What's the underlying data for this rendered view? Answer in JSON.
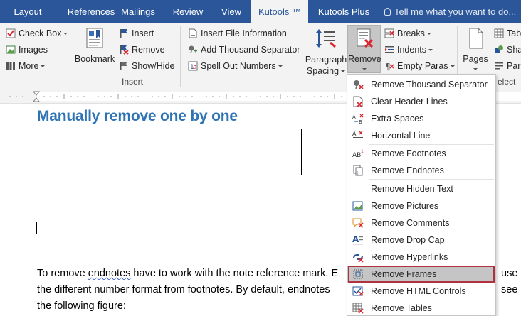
{
  "tabs": [
    "Layout",
    "References",
    "Mailings",
    "Review",
    "View",
    "Kutools ™",
    "Kutools Plus"
  ],
  "tell_me": "Tell me what you want to do...",
  "ribbon": {
    "checkbox": "Check Box",
    "images": "Images",
    "more": "More",
    "bookmark": "Bookmark",
    "insert": "Insert",
    "remove": "Remove",
    "show_hide": "Show/Hide",
    "group_insert": "Insert",
    "insert_file_info": "Insert File Information",
    "add_thousand_sep": "Add Thousand Separator",
    "spell_out_numbers": "Spell Out Numbers",
    "paragraph": "Paragraph",
    "spacing": "Spacing",
    "remove_big": "Remove",
    "breaks": "Breaks",
    "indents": "Indents",
    "empty_paras": "Empty Paras",
    "pages": "Pages",
    "table_short": "Tabl",
    "shape_short": "Shap",
    "para_short": "Para",
    "group_select": "elect"
  },
  "document": {
    "heading": "Manually remove one by one",
    "para_line1_a": "To remove ",
    "para_line1_b": "endnotes",
    "para_line1_c": " have to work with the note reference mark. E",
    "para_line1_end": "use",
    "para_line2": "the different number format from footnotes. By default, endnotes",
    "para_line2_end": "see",
    "para_line3": "the following figure:"
  },
  "menu": {
    "items": [
      {
        "label": "Remove Thousand Separator",
        "icon": "thousand-separator-icon"
      },
      {
        "label": "Clear Header Lines",
        "icon": "clear-header-lines-icon"
      },
      {
        "label": "Extra Spaces",
        "icon": "extra-spaces-icon"
      },
      {
        "label": "Horizontal Line",
        "icon": "horizontal-line-icon"
      },
      {
        "label": "Remove Footnotes",
        "icon": "footnotes-icon"
      },
      {
        "label": "Remove Endnotes",
        "icon": "endnotes-icon"
      },
      {
        "label": "Remove Hidden Text",
        "icon": "hidden-text-icon"
      },
      {
        "label": "Remove Pictures",
        "icon": "pictures-icon"
      },
      {
        "label": "Remove Comments",
        "icon": "comments-icon"
      },
      {
        "label": "Remove Drop Cap",
        "icon": "drop-cap-icon"
      },
      {
        "label": "Remove Hyperlinks",
        "icon": "hyperlinks-icon"
      },
      {
        "label": "Remove Frames",
        "icon": "frames-icon"
      },
      {
        "label": "Remove HTML Controls",
        "icon": "html-controls-icon"
      },
      {
        "label": "Remove Tables",
        "icon": "tables-icon"
      }
    ],
    "highlighted": "Remove Frames"
  },
  "colors": {
    "tab_bar": "#2b579a",
    "heading": "#2e74b5",
    "highlight_border": "#b0313f",
    "remove_red": "#d9262f"
  }
}
